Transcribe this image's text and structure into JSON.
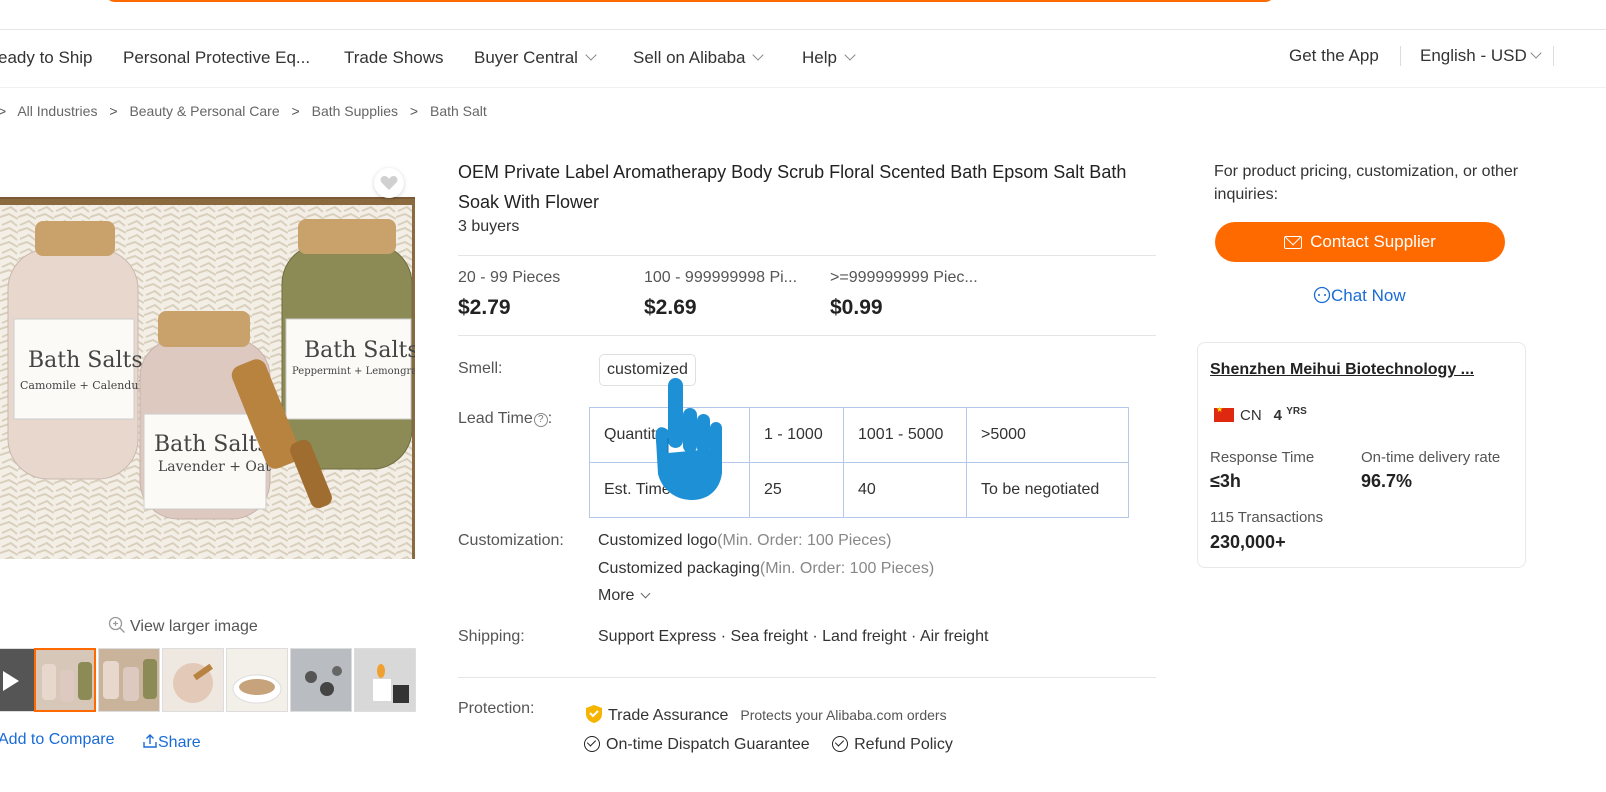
{
  "nav": {
    "items": [
      {
        "label": "eady to Ship",
        "dropdown": false
      },
      {
        "label": "Personal Protective Eq...",
        "dropdown": false
      },
      {
        "label": "Trade Shows",
        "dropdown": false
      },
      {
        "label": "Buyer Central",
        "dropdown": true
      },
      {
        "label": "Sell on Alibaba",
        "dropdown": true
      },
      {
        "label": "Help",
        "dropdown": true
      }
    ],
    "get_app": "Get the App",
    "language": "English - USD"
  },
  "breadcrumb": [
    "All Industries",
    "Beauty & Personal Care",
    "Bath Supplies",
    "Bath Salt"
  ],
  "gallery": {
    "main_image_labels": [
      {
        "top": "Bath Salts",
        "bottom": "Camomile + Calendula"
      },
      {
        "top": "Bath Salts",
        "bottom": "Lavender + Oat"
      },
      {
        "top": "Bath Salts",
        "bottom": "Peppermint + Lemongrass"
      }
    ],
    "view_larger": "View larger image",
    "add_compare": "Add to Compare",
    "share": "Share"
  },
  "product": {
    "title": "OEM Private Label Aromatherapy Body Scrub Floral Scented Bath Epsom Salt Bath Soak With Flower",
    "buyers": "3 buyers",
    "tiers": [
      {
        "qty": "20 - 99 Pieces",
        "price": "$2.79"
      },
      {
        "qty": "100 - 999999998 Pi...",
        "price": "$2.69"
      },
      {
        "qty": ">=999999999 Piec...",
        "price": "$0.99"
      }
    ],
    "smell_label": "Smell:",
    "smell_value": "customized",
    "lead_label": "Lead Time",
    "lead_help": "?",
    "lead_table": {
      "header": [
        "Quantity (...)",
        "1 - 1000",
        "1001 - 5000",
        ">5000"
      ],
      "row": [
        "Est. Time (...)",
        "25",
        "40",
        "To be negotiated"
      ]
    },
    "customization_label": "Customization:",
    "customization": [
      {
        "text": "Customized logo",
        "min": "(Min. Order: 100 Pieces)"
      },
      {
        "text": "Customized packaging",
        "min": "(Min. Order: 100 Pieces)"
      }
    ],
    "more": "More",
    "shipping_label": "Shipping:",
    "shipping_value": "Support Express · Sea freight · Land freight · Air freight",
    "protection_label": "Protection:",
    "trade_assurance": "Trade Assurance",
    "trade_assurance_desc": "Protects your Alibaba.com orders",
    "dispatch_guarantee": "On-time Dispatch Guarantee",
    "refund_policy": "Refund Policy"
  },
  "contact": {
    "inquiry_text": "For product pricing, customization, or other inquiries:",
    "contact_button": "Contact Supplier",
    "chat_now": "Chat Now"
  },
  "supplier": {
    "name": "Shenzhen Meihui Biotechnology ...",
    "country": "CN",
    "years": "4",
    "years_unit": "YRS",
    "response_time_label": "Response Time",
    "response_time": "≤3h",
    "on_time_label": "On-time delivery rate",
    "on_time": "96.7%",
    "transactions_label": "115 Transactions",
    "transactions_value": "230,000+"
  },
  "colors": {
    "accent": "#ff6a00",
    "link": "#1a6bd6",
    "cursor_hand": "#1e90d6"
  }
}
